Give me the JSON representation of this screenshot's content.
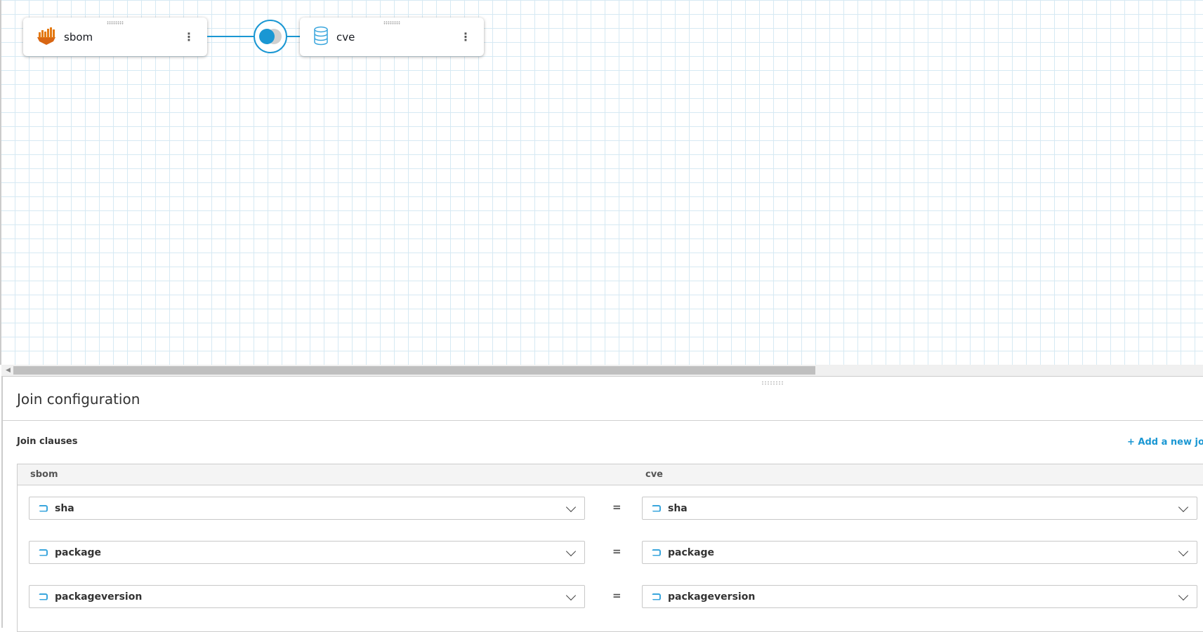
{
  "canvas": {
    "nodes": [
      {
        "label": "sbom",
        "icon": "amazon-athena-icon"
      },
      {
        "label": "cve",
        "icon": "database-icon"
      }
    ],
    "join_type": "left-join"
  },
  "panel": {
    "title": "Join configuration",
    "clauses_label": "Join clauses",
    "add_link": "+ Add a new join c",
    "columns": {
      "left": "sbom",
      "right": "cve"
    },
    "operator": "=",
    "rows": [
      {
        "left": "sha",
        "right": "sha"
      },
      {
        "left": "package",
        "right": "package"
      },
      {
        "left": "packageversion",
        "right": "packageversion"
      }
    ]
  }
}
